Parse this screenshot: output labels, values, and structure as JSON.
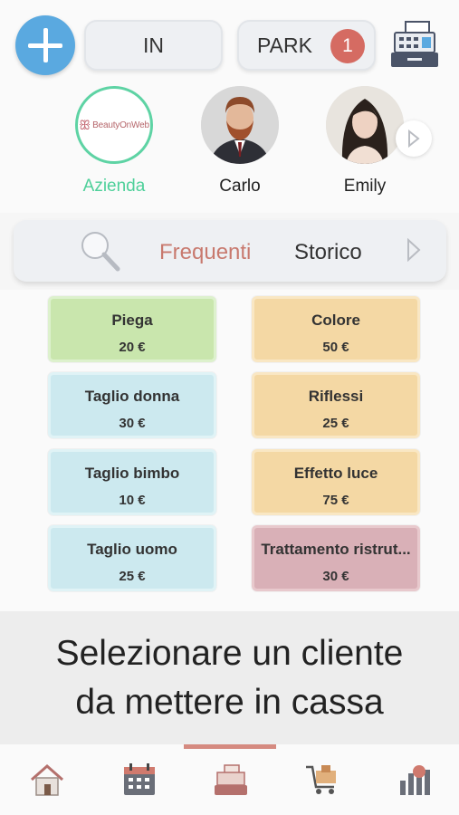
{
  "header": {
    "in_label": "IN",
    "park_label": "PARK",
    "park_count": "1"
  },
  "clients": [
    {
      "name": "Azienda",
      "logo_text": "BeautyOnWeb"
    },
    {
      "name": "Carlo"
    },
    {
      "name": "Emily"
    }
  ],
  "tabs": {
    "frequent": "Frequenti",
    "history": "Storico"
  },
  "services": [
    {
      "name": "Piega",
      "price": "20 €",
      "color": "#c9e6ad"
    },
    {
      "name": "Colore",
      "price": "50 €",
      "color": "#f4d8a4"
    },
    {
      "name": "Taglio donna",
      "price": "30 €",
      "color": "#cce9ef"
    },
    {
      "name": "Riflessi",
      "price": "25 €",
      "color": "#f4d8a4"
    },
    {
      "name": "Taglio bimbo",
      "price": "10 €",
      "color": "#cce9ef"
    },
    {
      "name": "Effetto luce",
      "price": "75 €",
      "color": "#f4d8a4"
    },
    {
      "name": "Taglio uomo",
      "price": "25 €",
      "color": "#cce9ef"
    },
    {
      "name": "Trattamento ristrut...",
      "price": "30 €",
      "color": "#d9b0b7"
    }
  ],
  "message": {
    "line1": "Selezionare un cliente",
    "line2": "da mettere in cassa"
  },
  "navigation": {
    "items": [
      "home-icon",
      "calendar-icon",
      "cash-register-icon",
      "cart-icon",
      "stats-icon"
    ],
    "active": "cash-register-icon"
  },
  "colors": {
    "accent_blue": "#5aa9e0",
    "badge_red": "#d56b62",
    "active_client_green": "#4ed09a",
    "frequent_tab": "#c8796e"
  }
}
